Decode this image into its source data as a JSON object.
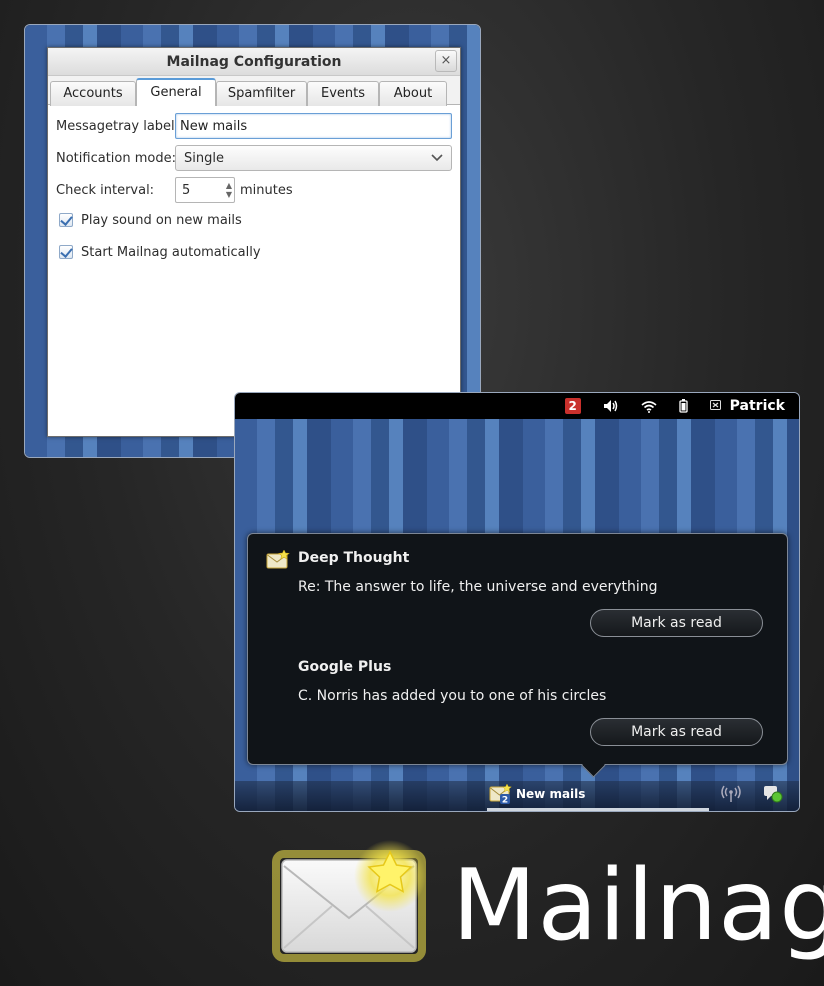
{
  "config_window": {
    "title": "Mailnag Configuration",
    "close_glyph": "×",
    "tabs": [
      {
        "label": "Accounts",
        "active": false
      },
      {
        "label": "General",
        "active": true
      },
      {
        "label": "Spamfilter",
        "active": false
      },
      {
        "label": "Events",
        "active": false
      },
      {
        "label": "About",
        "active": false
      }
    ],
    "general": {
      "messagetray_label": "Messagetray label:",
      "messagetray_value": "New mails",
      "notification_mode_label": "Notification mode:",
      "notification_mode_value": "Single",
      "check_interval_label": "Check interval:",
      "check_interval_value": "5",
      "check_interval_unit": "minutes",
      "play_sound_label": "Play sound on new mails",
      "play_sound_checked": true,
      "autostart_label": "Start Mailnag automatically",
      "autostart_checked": true
    }
  },
  "top_panel": {
    "mail_count_badge": "2",
    "icons": [
      "volume-icon",
      "wifi-icon",
      "battery-icon",
      "user-status-icon"
    ],
    "user_name": "Patrick"
  },
  "notification": {
    "mails": [
      {
        "sender": "Deep Thought",
        "subject": "Re: The answer to life, the universe and everything",
        "action": "Mark as read"
      },
      {
        "sender": "Google Plus",
        "subject": "C. Norris has added you to one of his circles",
        "action": "Mark as read"
      }
    ]
  },
  "message_tray": {
    "mail_item_label": "New mails",
    "mail_item_count": "2",
    "icons": [
      "network-icon",
      "chat-status-icon"
    ]
  },
  "branding": {
    "app_name": "Mailnag"
  },
  "colors": {
    "badge_red": "#c9302c",
    "accent_blue": "#5a9bd8",
    "wallpaper_blue": "#3a5f9c"
  }
}
